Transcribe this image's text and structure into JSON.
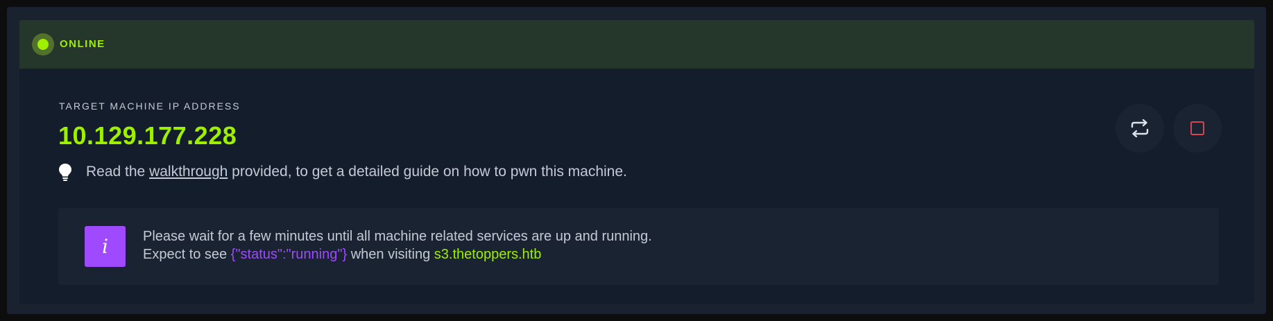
{
  "status": {
    "label": "ONLINE",
    "color": "#9fef00"
  },
  "target": {
    "label": "TARGET MACHINE IP ADDRESS",
    "ip": "10.129.177.228"
  },
  "tip": {
    "prefix": "Read the",
    "link_text": "walkthrough",
    "suffix": "provided, to get a detailed guide on how to pwn this machine.",
    "icon": "lightbulb-icon"
  },
  "actions": {
    "reset_icon": "reset-icon",
    "stop_icon": "stop-icon"
  },
  "info": {
    "icon_glyph": "i",
    "line1": "Please wait for a few minutes until all machine related services are up and running.",
    "line2_prefix": "Expect to see",
    "line2_code": "{\"status\":\"running\"}",
    "line2_middle": "when visiting",
    "line2_host": "s3.thetoppers.htb"
  },
  "colors": {
    "accent_green": "#9fef00",
    "accent_purple": "#9f4aff",
    "stop_red": "#d9434f"
  }
}
